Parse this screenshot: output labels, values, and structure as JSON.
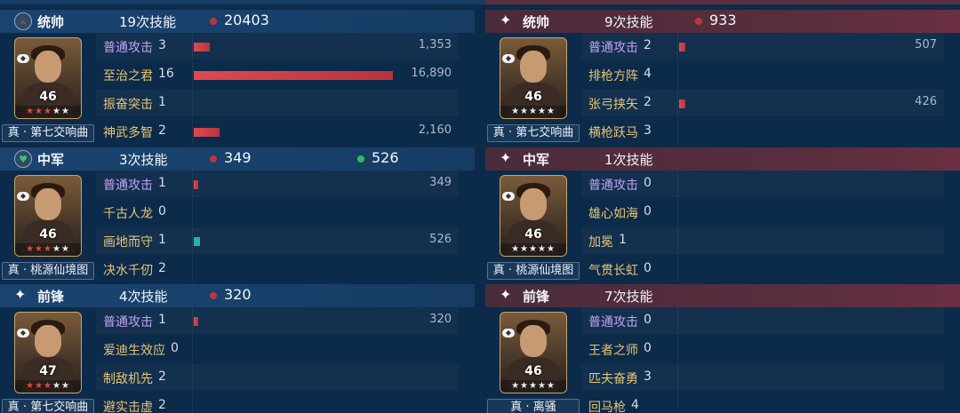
{
  "panels": [
    {
      "side": "left",
      "role": "统帅",
      "skills": "19次技能",
      "damage": "20403",
      "heal": "",
      "level": "46",
      "tag": "真 · 第七交响曲",
      "icon": "sword-icon",
      "rows": [
        {
          "name": "普通攻击",
          "count": "3",
          "value": "1,353",
          "fraction": 0.08,
          "basic": true
        },
        {
          "name": "至治之君",
          "count": "16",
          "value": "16,890",
          "fraction": 1.0,
          "basic": false
        },
        {
          "name": "振奋突击",
          "count": "1",
          "value": "",
          "fraction": 0,
          "basic": false
        },
        {
          "name": "神武多智",
          "count": "2",
          "value": "2,160",
          "fraction": 0.13,
          "basic": false
        }
      ]
    },
    {
      "side": "right",
      "role": "统帅",
      "skills": "9次技能",
      "damage": "933",
      "heal": "",
      "level": "46",
      "tag": "真 · 第七交响曲",
      "icon": "star-icon",
      "rows": [
        {
          "name": "普通攻击",
          "count": "2",
          "value": "507",
          "fraction": 0.03,
          "basic": true
        },
        {
          "name": "排枪方阵",
          "count": "4",
          "value": "",
          "fraction": 0,
          "basic": false
        },
        {
          "name": "张弓挟矢",
          "count": "2",
          "value": "426",
          "fraction": 0.03,
          "basic": false
        },
        {
          "name": "横枪跃马",
          "count": "3",
          "value": "",
          "fraction": 0,
          "basic": false
        }
      ]
    },
    {
      "side": "left",
      "role": "中军",
      "skills": "3次技能",
      "damage": "349",
      "heal": "526",
      "level": "46",
      "tag": "真 · 桃源仙境图",
      "icon": "heart-icon",
      "rows": [
        {
          "name": "普通攻击",
          "count": "1",
          "value": "349",
          "fraction": 0.02,
          "basic": true
        },
        {
          "name": "千古人龙",
          "count": "0",
          "value": "",
          "fraction": 0,
          "basic": false
        },
        {
          "name": "画地而守",
          "count": "1",
          "value": "526",
          "fraction": 0.03,
          "basic": false,
          "teal": true
        },
        {
          "name": "决水千仞",
          "count": "2",
          "value": "",
          "fraction": 0,
          "basic": false
        }
      ]
    },
    {
      "side": "right",
      "role": "中军",
      "skills": "1次技能",
      "damage": "",
      "heal": "",
      "level": "46",
      "tag": "真 · 桃源仙境图",
      "icon": "star-icon",
      "rows": [
        {
          "name": "普通攻击",
          "count": "0",
          "value": "",
          "fraction": 0,
          "basic": true
        },
        {
          "name": "雄心如海",
          "count": "0",
          "value": "",
          "fraction": 0,
          "basic": false
        },
        {
          "name": "加冕",
          "count": "1",
          "value": "",
          "fraction": 0,
          "basic": false
        },
        {
          "name": "气贯长虹",
          "count": "0",
          "value": "",
          "fraction": 0,
          "basic": false
        }
      ]
    },
    {
      "side": "left",
      "role": "前锋",
      "skills": "4次技能",
      "damage": "320",
      "heal": "",
      "level": "47",
      "tag": "真 · 第七交响曲",
      "icon": "star-icon",
      "rows": [
        {
          "name": "普通攻击",
          "count": "1",
          "value": "320",
          "fraction": 0.02,
          "basic": true
        },
        {
          "name": "爱迪生效应",
          "count": "0",
          "value": "",
          "fraction": 0,
          "basic": false
        },
        {
          "name": "制敌机先",
          "count": "2",
          "value": "",
          "fraction": 0,
          "basic": false
        },
        {
          "name": "避实击虚",
          "count": "2",
          "value": "",
          "fraction": 0,
          "basic": false
        }
      ]
    },
    {
      "side": "right",
      "role": "前锋",
      "skills": "7次技能",
      "damage": "",
      "heal": "",
      "level": "46",
      "tag": "真 · 离骚",
      "icon": "star-icon",
      "rows": [
        {
          "name": "普通攻击",
          "count": "0",
          "value": "",
          "fraction": 0,
          "basic": true
        },
        {
          "name": "王者之师",
          "count": "0",
          "value": "",
          "fraction": 0,
          "basic": false
        },
        {
          "name": "匹夫奋勇",
          "count": "3",
          "value": "",
          "fraction": 0,
          "basic": false
        },
        {
          "name": "回马枪",
          "count": "4",
          "value": "",
          "fraction": 0,
          "basic": false
        }
      ]
    }
  ],
  "colors": {
    "damage_dot": "#c0353b",
    "heal_dot": "#2fbf5a",
    "bar": "#d9404a",
    "heal_bar": "#2bb0a8"
  }
}
